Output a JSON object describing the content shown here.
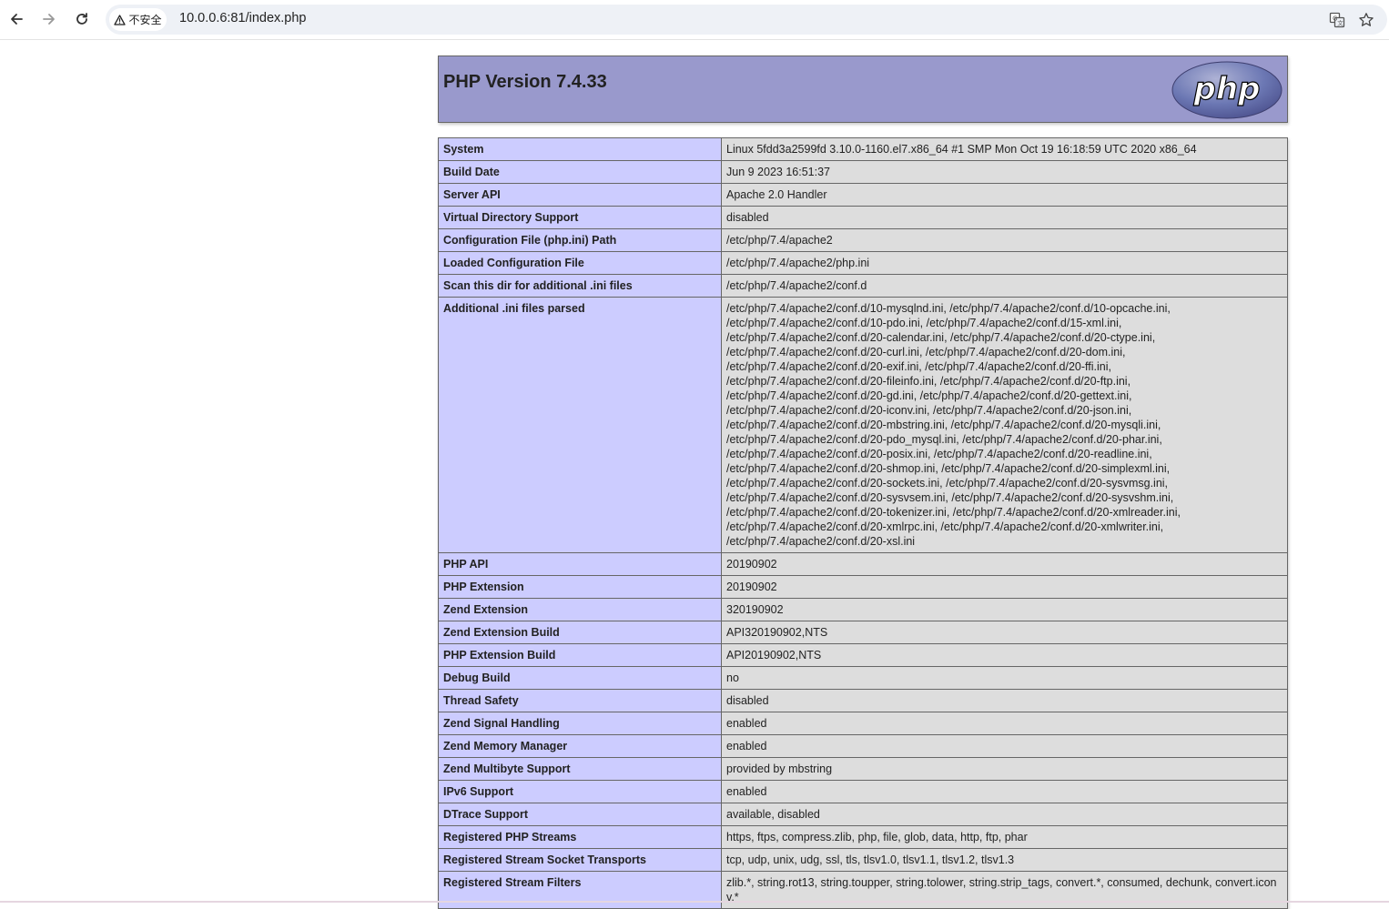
{
  "browser": {
    "security_label": "不安全",
    "url": "10.0.0.6:81/index.php"
  },
  "header": {
    "title": "PHP Version 7.4.33",
    "logo_text": "php"
  },
  "rows": [
    {
      "label": "System",
      "value": "Linux 5fdd3a2599fd 3.10.0-1160.el7.x86_64 #1 SMP Mon Oct 19 16:18:59 UTC 2020 x86_64"
    },
    {
      "label": "Build Date",
      "value": "Jun 9 2023 16:51:37"
    },
    {
      "label": "Server API",
      "value": "Apache 2.0 Handler"
    },
    {
      "label": "Virtual Directory Support",
      "value": "disabled"
    },
    {
      "label": "Configuration File (php.ini) Path",
      "value": "/etc/php/7.4/apache2"
    },
    {
      "label": "Loaded Configuration File",
      "value": "/etc/php/7.4/apache2/php.ini"
    },
    {
      "label": "Scan this dir for additional .ini files",
      "value": "/etc/php/7.4/apache2/conf.d"
    },
    {
      "label": "Additional .ini files parsed",
      "value": "/etc/php/7.4/apache2/conf.d/10-mysqlnd.ini, /etc/php/7.4/apache2/conf.d/10-opcache.ini,\n/etc/php/7.4/apache2/conf.d/10-pdo.ini, /etc/php/7.4/apache2/conf.d/15-xml.ini,\n/etc/php/7.4/apache2/conf.d/20-calendar.ini, /etc/php/7.4/apache2/conf.d/20-ctype.ini,\n/etc/php/7.4/apache2/conf.d/20-curl.ini, /etc/php/7.4/apache2/conf.d/20-dom.ini,\n/etc/php/7.4/apache2/conf.d/20-exif.ini, /etc/php/7.4/apache2/conf.d/20-ffi.ini,\n/etc/php/7.4/apache2/conf.d/20-fileinfo.ini, /etc/php/7.4/apache2/conf.d/20-ftp.ini,\n/etc/php/7.4/apache2/conf.d/20-gd.ini, /etc/php/7.4/apache2/conf.d/20-gettext.ini,\n/etc/php/7.4/apache2/conf.d/20-iconv.ini, /etc/php/7.4/apache2/conf.d/20-json.ini,\n/etc/php/7.4/apache2/conf.d/20-mbstring.ini, /etc/php/7.4/apache2/conf.d/20-mysqli.ini,\n/etc/php/7.4/apache2/conf.d/20-pdo_mysql.ini, /etc/php/7.4/apache2/conf.d/20-phar.ini,\n/etc/php/7.4/apache2/conf.d/20-posix.ini, /etc/php/7.4/apache2/conf.d/20-readline.ini,\n/etc/php/7.4/apache2/conf.d/20-shmop.ini, /etc/php/7.4/apache2/conf.d/20-simplexml.ini,\n/etc/php/7.4/apache2/conf.d/20-sockets.ini, /etc/php/7.4/apache2/conf.d/20-sysvmsg.ini,\n/etc/php/7.4/apache2/conf.d/20-sysvsem.ini, /etc/php/7.4/apache2/conf.d/20-sysvshm.ini,\n/etc/php/7.4/apache2/conf.d/20-tokenizer.ini, /etc/php/7.4/apache2/conf.d/20-xmlreader.ini,\n/etc/php/7.4/apache2/conf.d/20-xmlrpc.ini, /etc/php/7.4/apache2/conf.d/20-xmlwriter.ini,\n/etc/php/7.4/apache2/conf.d/20-xsl.ini"
    },
    {
      "label": "PHP API",
      "value": "20190902"
    },
    {
      "label": "PHP Extension",
      "value": "20190902"
    },
    {
      "label": "Zend Extension",
      "value": "320190902"
    },
    {
      "label": "Zend Extension Build",
      "value": "API320190902,NTS"
    },
    {
      "label": "PHP Extension Build",
      "value": "API20190902,NTS"
    },
    {
      "label": "Debug Build",
      "value": "no"
    },
    {
      "label": "Thread Safety",
      "value": "disabled"
    },
    {
      "label": "Zend Signal Handling",
      "value": "enabled"
    },
    {
      "label": "Zend Memory Manager",
      "value": "enabled"
    },
    {
      "label": "Zend Multibyte Support",
      "value": "provided by mbstring"
    },
    {
      "label": "IPv6 Support",
      "value": "enabled"
    },
    {
      "label": "DTrace Support",
      "value": "available, disabled"
    },
    {
      "label": "Registered PHP Streams",
      "value": "https, ftps, compress.zlib, php, file, glob, data, http, ftp, phar"
    },
    {
      "label": "Registered Stream Socket Transports",
      "value": "tcp, udp, unix, udg, ssl, tls, tlsv1.0, tlsv1.1, tlsv1.2, tlsv1.3"
    },
    {
      "label": "Registered Stream Filters",
      "value": "zlib.*, string.rot13, string.toupper, string.tolower, string.strip_tags, convert.*, consumed, dechunk, convert.iconv.*"
    }
  ]
}
